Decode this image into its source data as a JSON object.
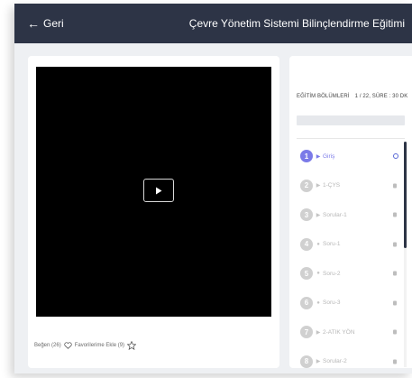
{
  "header": {
    "back_label": "Geri",
    "title": "Çevre Yönetim Sistemi Bilinçlendirme Eğitimi"
  },
  "video": {
    "actions": {
      "like_label": "Beğen (26)",
      "favorite_label": "Favorilerime Ekle (9)"
    }
  },
  "sidebar": {
    "heading": "EĞİTİM BÖLÜMLERİ",
    "progress_text": "1 / 22, SÜRE : 30 DK",
    "progress_fraction": 0.0,
    "scroll_fraction": 0.47,
    "lessons": [
      {
        "num": "1",
        "label": "Giriş",
        "icon": "play-icon",
        "active": true
      },
      {
        "num": "2",
        "label": "1-ÇYS",
        "icon": "play-icon",
        "active": false
      },
      {
        "num": "3",
        "label": "Sorular-1",
        "icon": "play-icon",
        "active": false
      },
      {
        "num": "4",
        "label": "Soru-1",
        "icon": "dot-icon",
        "active": false
      },
      {
        "num": "5",
        "label": "Soru-2",
        "icon": "dot-icon",
        "active": false
      },
      {
        "num": "6",
        "label": "Soru-3",
        "icon": "dot-icon",
        "active": false
      },
      {
        "num": "7",
        "label": "2-ATIK YÖN",
        "icon": "play-icon",
        "active": false
      },
      {
        "num": "8",
        "label": "Sorular-2",
        "icon": "play-icon",
        "active": false
      }
    ]
  },
  "colors": {
    "topbar": "#2d3446",
    "accent": "#7b7ae8",
    "page_bg": "#eef0f3"
  }
}
